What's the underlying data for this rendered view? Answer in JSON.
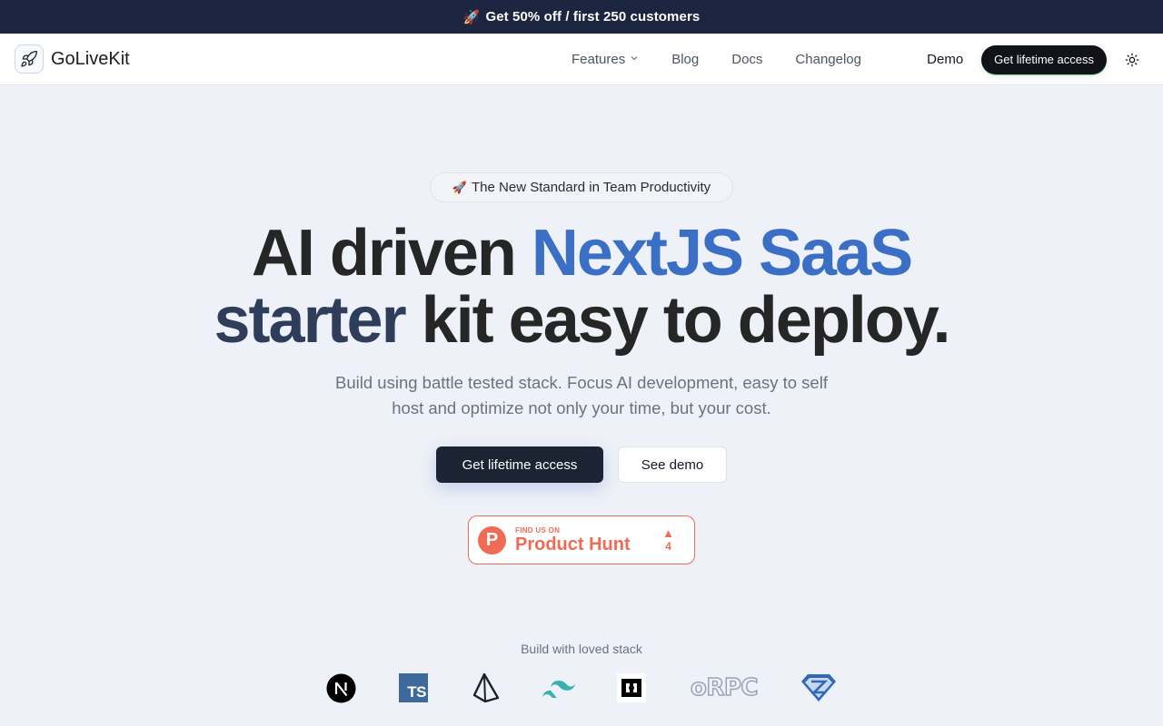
{
  "banner": {
    "rocket": "🚀",
    "text": "Get 50% off / first 250 customers"
  },
  "nav": {
    "logo_icon": "rocket-icon",
    "brand": "GoLiveKit",
    "links": [
      {
        "label": "Features",
        "has_dropdown": true
      },
      {
        "label": "Blog"
      },
      {
        "label": "Docs"
      },
      {
        "label": "Changelog"
      }
    ],
    "demo_label": "Demo",
    "cta_label": "Get lifetime access",
    "theme_icon": "sun-icon"
  },
  "hero": {
    "pill_rocket": "🚀",
    "pill_text": "The New Standard in Team Productivity",
    "headline": {
      "part1": "AI driven ",
      "part2_blue": "NextJS SaaS",
      "part3_navy": "starter",
      "part4": " kit easy to deploy."
    },
    "subtitle_line1": "Build using battle tested stack. Focus AI development, easy to self",
    "subtitle_line2": "host and optimize not only your time, but your cost.",
    "primary_button": "Get lifetime access",
    "secondary_button": "See demo"
  },
  "product_hunt": {
    "logo_letter": "P",
    "small_text": "FIND US ON",
    "big_text": "Product Hunt",
    "upvote_icon": "▲",
    "count": "4"
  },
  "stack": {
    "label": "Build with loved stack",
    "items": [
      {
        "name": "nextjs-logo"
      },
      {
        "name": "typescript-logo",
        "text": "TS"
      },
      {
        "name": "prisma-logo"
      },
      {
        "name": "tailwind-logo"
      },
      {
        "name": "hono-logo"
      },
      {
        "name": "orpc-logo",
        "text": "oRPC"
      },
      {
        "name": "zod-logo"
      }
    ]
  },
  "colors": {
    "banner_bg": "#1c2640",
    "headline_blue": "#3b6fc6",
    "headline_navy": "#2d3d5a",
    "product_hunt": "#ef6b55",
    "primary_button_bg": "#1c2434"
  }
}
